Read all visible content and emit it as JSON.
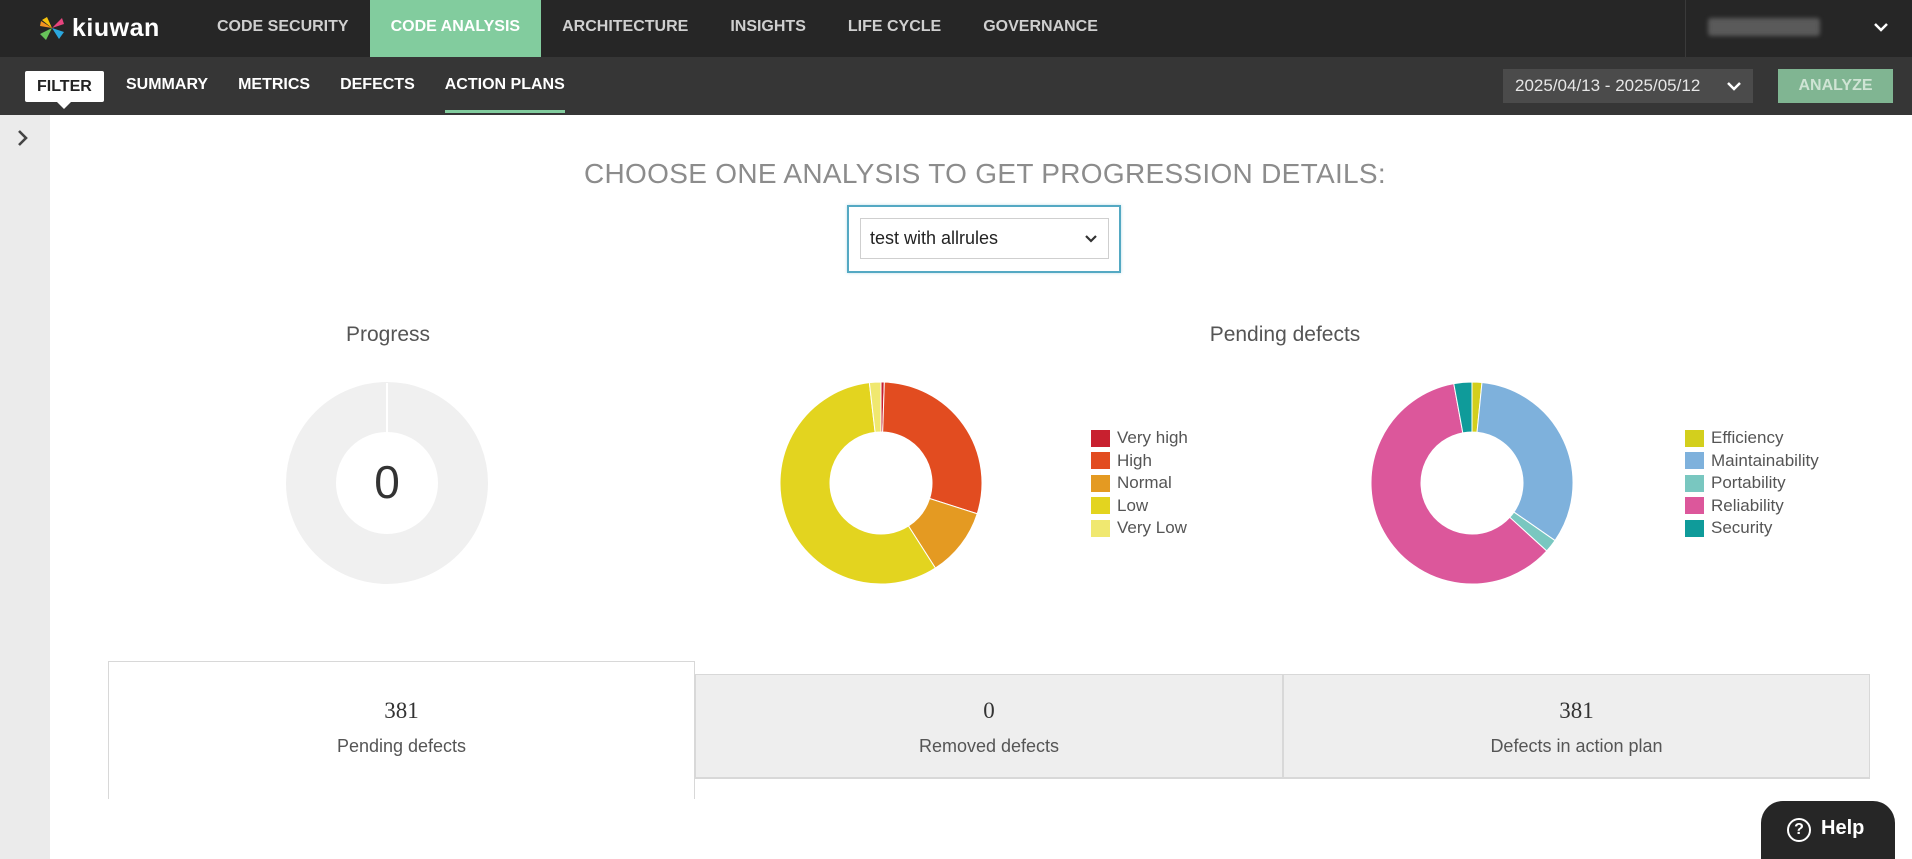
{
  "app": {
    "logo_text": "kiuwan"
  },
  "topnav": {
    "items": [
      {
        "label": "CODE SECURITY",
        "active": false
      },
      {
        "label": "CODE ANALYSIS",
        "active": true
      },
      {
        "label": "ARCHITECTURE",
        "active": false
      },
      {
        "label": "INSIGHTS",
        "active": false
      },
      {
        "label": "LIFE CYCLE",
        "active": false
      },
      {
        "label": "GOVERNANCE",
        "active": false
      }
    ],
    "user_menu_icon": "chevron-down-icon"
  },
  "subnav": {
    "filter_label": "FILTER",
    "items": [
      {
        "label": "SUMMARY",
        "active": false
      },
      {
        "label": "METRICS",
        "active": false
      },
      {
        "label": "DEFECTS",
        "active": false
      },
      {
        "label": "ACTION PLANS",
        "active": true
      }
    ],
    "date_range": "2025/04/13 - 2025/05/12",
    "analyze_label": "ANALYZE"
  },
  "main": {
    "heading": "CHOOSE ONE ANALYSIS TO GET PROGRESSION DETAILS:",
    "analysis_select": {
      "value": "test with allrules"
    }
  },
  "progress": {
    "title": "Progress",
    "value": "0"
  },
  "pending": {
    "title": "Pending defects",
    "priority_legend": [
      {
        "label": "Very high",
        "color": "#c8202f"
      },
      {
        "label": "High",
        "color": "#e24c20"
      },
      {
        "label": "Normal",
        "color": "#e49a22"
      },
      {
        "label": "Low",
        "color": "#e3d41f"
      },
      {
        "label": "Very Low",
        "color": "#f0e870"
      }
    ],
    "characteristic_legend": [
      {
        "label": "Efficiency",
        "color": "#d3cf1d"
      },
      {
        "label": "Maintainability",
        "color": "#7eb1dc"
      },
      {
        "label": "Portability",
        "color": "#79c7c0"
      },
      {
        "label": "Reliability",
        "color": "#dc579b"
      },
      {
        "label": "Security",
        "color": "#0f9b9a"
      }
    ]
  },
  "chart_data": [
    {
      "type": "pie",
      "title": "Progress",
      "categories": [
        "Progress"
      ],
      "values": [
        0
      ],
      "center_label": "0",
      "colors": [
        "#f0f0f0"
      ]
    },
    {
      "type": "pie",
      "title": "Pending defects",
      "categories": [
        "Very high",
        "High",
        "Normal",
        "Low",
        "Very Low"
      ],
      "values": [
        2,
        112,
        42,
        218,
        7
      ],
      "colors": [
        "#c8202f",
        "#e24c20",
        "#e49a22",
        "#e3d41f",
        "#f0e870"
      ],
      "legend": "right"
    },
    {
      "type": "pie",
      "categories": [
        "Efficiency",
        "Maintainability",
        "Portability",
        "Reliability",
        "Security"
      ],
      "values": [
        6,
        126,
        8,
        230,
        11
      ],
      "colors": [
        "#d3cf1d",
        "#7eb1dc",
        "#79c7c0",
        "#dc579b",
        "#0f9b9a"
      ],
      "legend": "right"
    }
  ],
  "stats": [
    {
      "value": "381",
      "label": "Pending defects",
      "active": true
    },
    {
      "value": "0",
      "label": "Removed defects",
      "active": false
    },
    {
      "value": "381",
      "label": "Defects in action plan",
      "active": false
    }
  ],
  "help": {
    "label": "Help"
  }
}
